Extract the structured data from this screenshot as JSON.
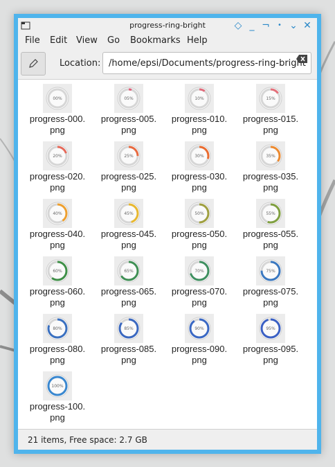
{
  "window": {
    "title": "progress-ring-bright"
  },
  "menu": [
    "File",
    "Edit",
    "View",
    "Go",
    "Bookmarks",
    "Help"
  ],
  "toolbar": {
    "location_label": "Location:",
    "path": "/home/epsi/Documents/progress-ring-bright"
  },
  "files": [
    {
      "pct": 0,
      "label": "00%",
      "color": "#cccccc",
      "line1": "progress-000.",
      "line2": "png"
    },
    {
      "pct": 5,
      "label": "05%",
      "color": "#e0607a",
      "line1": "progress-005.",
      "line2": "png"
    },
    {
      "pct": 10,
      "label": "10%",
      "color": "#e06a7a",
      "line1": "progress-010.",
      "line2": "png"
    },
    {
      "pct": 15,
      "label": "15%",
      "color": "#e4707a",
      "line1": "progress-015.",
      "line2": "png"
    },
    {
      "pct": 20,
      "label": "20%",
      "color": "#e66a5a",
      "line1": "progress-020.",
      "line2": "png"
    },
    {
      "pct": 25,
      "label": "25%",
      "color": "#e86a40",
      "line1": "progress-025.",
      "line2": "png"
    },
    {
      "pct": 30,
      "label": "30%",
      "color": "#ea6c30",
      "line1": "progress-030.",
      "line2": "png"
    },
    {
      "pct": 35,
      "label": "35%",
      "color": "#ec8a30",
      "line1": "progress-035.",
      "line2": "png"
    },
    {
      "pct": 40,
      "label": "40%",
      "color": "#eea030",
      "line1": "progress-040.",
      "line2": "png"
    },
    {
      "pct": 45,
      "label": "45%",
      "color": "#e8b830",
      "line1": "progress-045.",
      "line2": "png"
    },
    {
      "pct": 50,
      "label": "50%",
      "color": "#a0a040",
      "line1": "progress-050.",
      "line2": "png"
    },
    {
      "pct": 55,
      "label": "55%",
      "color": "#80a040",
      "line1": "progress-055.",
      "line2": "png"
    },
    {
      "pct": 60,
      "label": "60%",
      "color": "#3f9048",
      "line1": "progress-060.",
      "line2": "png"
    },
    {
      "pct": 65,
      "label": "65%",
      "color": "#3f9055",
      "line1": "progress-065.",
      "line2": "png"
    },
    {
      "pct": 70,
      "label": "70%",
      "color": "#3f9060",
      "line1": "progress-070.",
      "line2": "png"
    },
    {
      "pct": 75,
      "label": "75%",
      "color": "#3a78c0",
      "line1": "progress-075.",
      "line2": "png"
    },
    {
      "pct": 80,
      "label": "80%",
      "color": "#3a70c0",
      "line1": "progress-080.",
      "line2": "png"
    },
    {
      "pct": 85,
      "label": "85%",
      "color": "#3a68c0",
      "line1": "progress-085.",
      "line2": "png"
    },
    {
      "pct": 90,
      "label": "90%",
      "color": "#3a68c4",
      "line1": "progress-090.",
      "line2": "png"
    },
    {
      "pct": 95,
      "label": "95%",
      "color": "#3a60c4",
      "line1": "progress-095.",
      "line2": "png"
    },
    {
      "pct": 100,
      "label": "100%",
      "color": "#3a88d0",
      "line1": "progress-100.",
      "line2": "png"
    }
  ],
  "status": {
    "text": "21 items, Free space: 2.7 GB"
  },
  "colors": {
    "frame": "#4fb4ec",
    "wm_buttons": "#2a88c8"
  }
}
